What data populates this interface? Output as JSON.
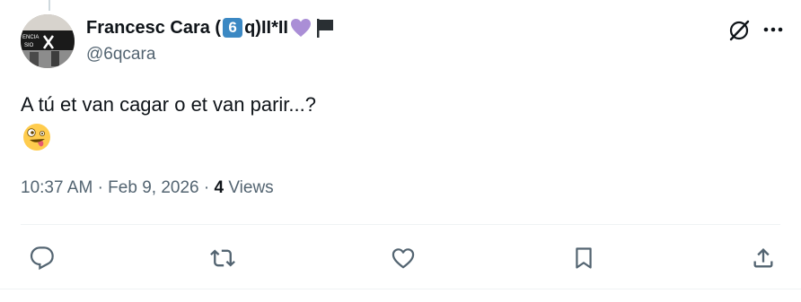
{
  "tweet": {
    "author": {
      "display_name": "Francesc Cara (",
      "keycap_digit": "6",
      "name_suffix": "q)II*II",
      "handle": "@6qcara"
    },
    "text": "A tú et van cagar o et van parir...?",
    "emoji": "zany-face",
    "time": "10:37 AM",
    "date": "Feb 9, 2026",
    "views_count": "4",
    "views_label": "Views"
  },
  "colors": {
    "text_primary": "#0f1419",
    "text_secondary": "#536471",
    "keycap_blue": "#3b88c3",
    "heart_purple": "#aa8ed6",
    "divider": "#eff3f4"
  },
  "icons": [
    "grok-icon",
    "more-icon",
    "reply-icon",
    "retweet-icon",
    "like-icon",
    "bookmark-icon",
    "share-icon"
  ]
}
